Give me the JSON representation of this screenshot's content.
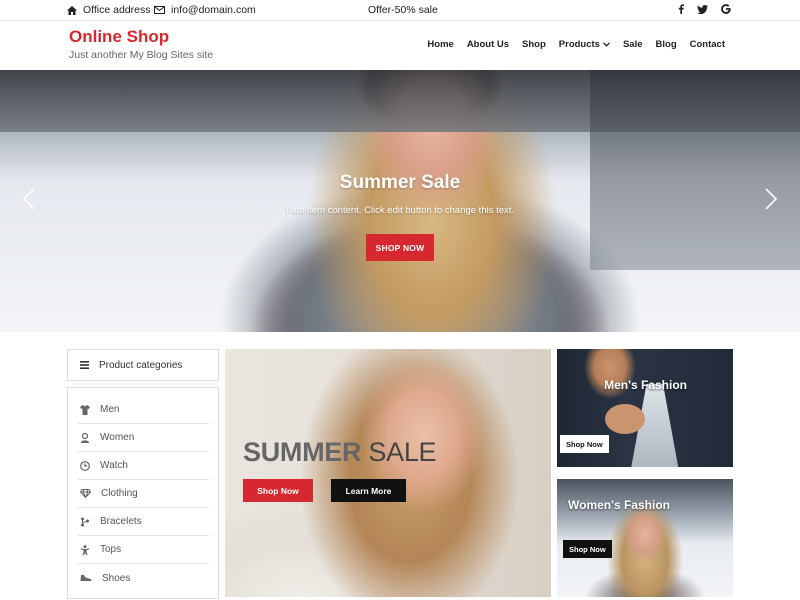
{
  "topbar": {
    "address": "Office address",
    "email": "info@domain.com",
    "offer": "Offer-50% sale",
    "social": [
      "facebook-icon",
      "twitter-icon",
      "google-icon"
    ]
  },
  "header": {
    "logo": "Online Shop",
    "tagline": "Just another My Blog Sites site",
    "nav": [
      "Home",
      "About Us",
      "Shop",
      "Products",
      "Sale",
      "Blog",
      "Contact"
    ]
  },
  "hero": {
    "title": "Summer Sale",
    "text": "I am item content. Click edit button to change this text.",
    "button": "SHOP NOW"
  },
  "categories": {
    "heading": "Product categories",
    "items": [
      {
        "label": "Men",
        "icon": "shirt-icon"
      },
      {
        "label": "Women",
        "icon": "person-icon"
      },
      {
        "label": "Watch",
        "icon": "clock-icon"
      },
      {
        "label": "Clothing",
        "icon": "diamond-icon"
      },
      {
        "label": "Bracelets",
        "icon": "bracelet-icon"
      },
      {
        "label": "Tops",
        "icon": "child-icon"
      },
      {
        "label": "Shoes",
        "icon": "shoe-icon"
      }
    ]
  },
  "promo": {
    "title_bold": "SUMMER",
    "title_light": "SALE",
    "shop_now": "Shop Now",
    "learn_more": "Learn More"
  },
  "tiles": {
    "mens": {
      "title": "Men's Fashion",
      "button": "Shop Now"
    },
    "womens": {
      "title": "Women's Fashion",
      "button": "Shop Now"
    }
  },
  "colors": {
    "accent": "#d7282f",
    "dark": "#111111"
  }
}
